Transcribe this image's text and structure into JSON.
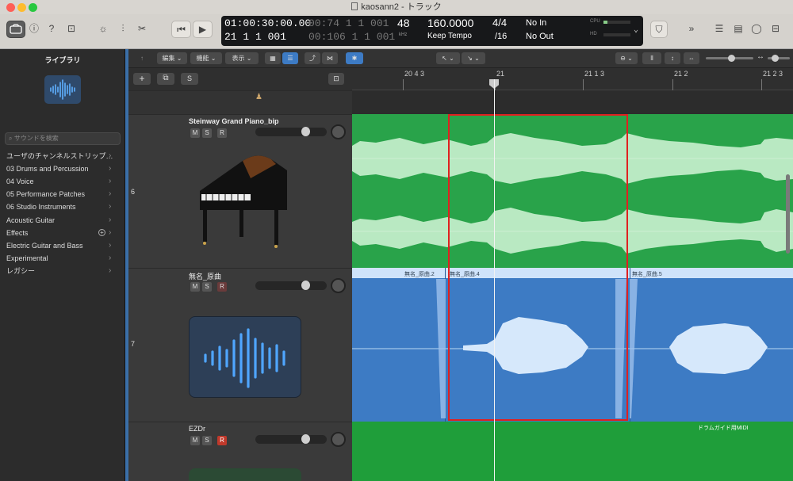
{
  "window": {
    "title": "kaosann2 - トラック"
  },
  "lcd": {
    "time": "01:00:30:00.00",
    "time_tail": "00:74 1 1 001",
    "bars": "21 1 1 001",
    "bars_tail": "00:106 1 1 001",
    "sample_rate": "48",
    "sample_rate_unit": "kHz",
    "tempo": "160.0000",
    "tempo_mode": "Keep Tempo",
    "signature": "4/4",
    "division": "/16",
    "midi_in": "No In",
    "midi_out": "No Out",
    "cpu_label": "CPU",
    "hd_label": "HD"
  },
  "toolbar": {
    "edit_menu": "編集",
    "function_menu": "機能",
    "view_menu": "表示"
  },
  "library": {
    "title": "ライブラリ",
    "search_placeholder": "サウンドを検索",
    "items": [
      {
        "label": "ユーザのチャンネルストリップ…"
      },
      {
        "label": "03 Drums and Percussion"
      },
      {
        "label": "04 Voice"
      },
      {
        "label": "05 Performance Patches"
      },
      {
        "label": "06 Studio Instruments"
      },
      {
        "label": "Acoustic Guitar"
      },
      {
        "label": "Effects"
      },
      {
        "label": "Electric Guitar and Bass"
      },
      {
        "label": "Experimental"
      },
      {
        "label": "レガシー"
      }
    ]
  },
  "ruler": {
    "markers": [
      "20 4 3",
      "21",
      "21 1 3",
      "21 2",
      "21 2 3"
    ]
  },
  "tracks": [
    {
      "number": "6",
      "name": "Steinway Grand Piano_bip",
      "mute": "M",
      "solo": "S",
      "record": "R"
    },
    {
      "number": "7",
      "name": "無名_原曲",
      "mute": "M",
      "solo": "S",
      "record": "R"
    },
    {
      "number": "",
      "name": "EZDr",
      "mute": "M",
      "solo": "S",
      "record": "R"
    }
  ],
  "regions": {
    "audio": [
      "無名_原曲.2",
      "無名_原曲.4",
      "無名_原曲.5"
    ],
    "midi": "ドラムガイド用MIDI"
  },
  "header_buttons": {
    "add": "+",
    "solo_all": "S"
  },
  "colors": {
    "piano_region": "#29a34a",
    "audio_region": "#3d7bc4",
    "midi_region": "#1f9e3a",
    "selection": "#e02020"
  }
}
